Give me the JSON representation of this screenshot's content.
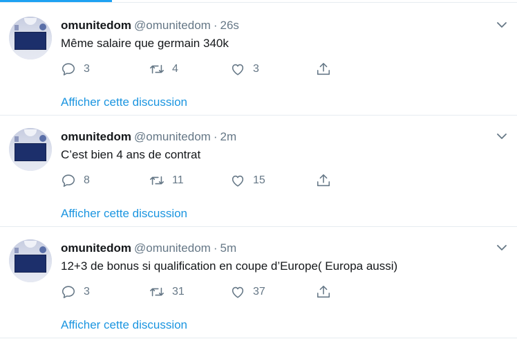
{
  "colors": {
    "accent": "#1da1f2",
    "link": "#1b95e0",
    "muted": "#657786",
    "text": "#14171a"
  },
  "tweets": [
    {
      "name": "omunitedom",
      "handle": "@omunitedom",
      "separator": "·",
      "time": "26s",
      "text": "Même salaire que germain 340k",
      "replies": "3",
      "retweets": "4",
      "likes": "3",
      "show_thread": "Afficher cette discussion"
    },
    {
      "name": "omunitedom",
      "handle": "@omunitedom",
      "separator": "·",
      "time": "2m",
      "text": "C’est bien 4 ans de contrat",
      "replies": "8",
      "retweets": "11",
      "likes": "15",
      "show_thread": "Afficher cette discussion"
    },
    {
      "name": "omunitedom",
      "handle": "@omunitedom",
      "separator": "·",
      "time": "5m",
      "text": "12+3 de bonus si qualification en coupe d’Europe( Europa aussi)",
      "replies": "3",
      "retweets": "31",
      "likes": "37",
      "show_thread": "Afficher cette discussion"
    }
  ],
  "icons": {
    "reply": "reply-icon",
    "retweet": "retweet-icon",
    "like": "heart-icon",
    "share": "share-icon",
    "more": "chevron-down-icon"
  }
}
